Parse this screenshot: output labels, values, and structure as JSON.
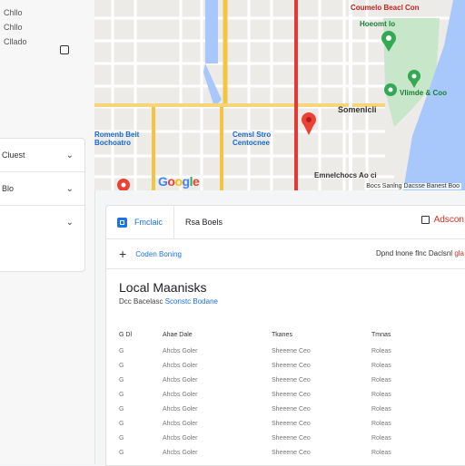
{
  "sidebar": {
    "top_items": [
      "Chllo",
      "Chllo",
      "Cllado"
    ],
    "panel_items": [
      {
        "label": "Cluest"
      },
      {
        "label": "Blo"
      },
      {
        "label": ""
      }
    ]
  },
  "map": {
    "labels": {
      "top_right": "Coumelo Beacl Con",
      "park": "Hoeomt lo",
      "center": "Somenlcli",
      "park2": "Vlimde & Coo",
      "left_block": "Romenb Beit\nBochoatro",
      "mid_block": "Cemsl Stro\nCentocnee",
      "lower": "Emnelchocs Ao ci",
      "footer": "Bocs Sanlng Dacsse Banest Boo"
    },
    "logo": "Google",
    "colors": {
      "water": "#a8c7fa",
      "park": "#c8e6c9",
      "road_yellow": "#f5c542",
      "road_red": "#e53935",
      "marker_green": "#34a853",
      "marker_red": "#ea4335"
    }
  },
  "panel": {
    "tabs": [
      {
        "label": "Fmclaic",
        "active": true,
        "icon": "grid-icon"
      },
      {
        "label": "Rsa Boels",
        "active": false
      }
    ],
    "add_button": "Adscon",
    "toolbar": {
      "action": "Coden Boning",
      "right_text": "Dpnd lnone flnc Daclsnl",
      "right_link": "gla"
    },
    "title": "Local Maanisks",
    "subtitle": {
      "prefix": "Dcc Bacelasc",
      "link": "Sconstc Bodane"
    },
    "table": {
      "headers": [
        "G Dl",
        "Ahae Dale",
        "Tkanes",
        "Tmnas"
      ],
      "rows": [
        [
          "G",
          "Ahcbs Goler",
          "Sheeene Ceo",
          "Roleas"
        ],
        [
          "G",
          "Ahcbs Goler",
          "Sheeene Ceo",
          "Roleas"
        ],
        [
          "G",
          "Ahcbs Goler",
          "Sheeene Ceo",
          "Roleas"
        ],
        [
          "G",
          "Ahcbs Goler",
          "Sheeene Ceo",
          "Roleas"
        ],
        [
          "G",
          "Ahcbs Goler",
          "Sheeene Ceo",
          "Roleas"
        ],
        [
          "G",
          "Ahcbs Goler",
          "Sheeene Ceo",
          "Roleas"
        ],
        [
          "G",
          "Ahcbs Goler",
          "Sheeene Ceo",
          "Roleas"
        ],
        [
          "G",
          "Ahcbs Goler",
          "Sheeene Ceo",
          "Roleas"
        ]
      ]
    }
  }
}
